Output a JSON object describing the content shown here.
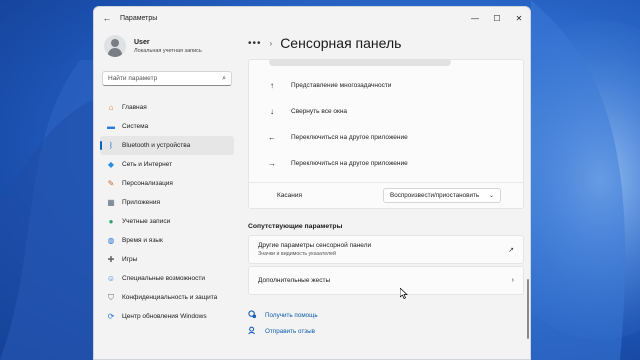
{
  "window": {
    "app_title": "Параметры",
    "back_icon": "←",
    "controls": {
      "minimize": "—",
      "maximize": "☐",
      "close": "✕"
    }
  },
  "user": {
    "name": "User",
    "account_type": "Локальная учетная запись"
  },
  "search": {
    "placeholder": "Найти параметр",
    "icon": "⌕"
  },
  "sidebar": {
    "items": [
      {
        "label": "Главная",
        "icon": "home-icon",
        "glyph": "⌂",
        "color": "#e07b39",
        "active": false
      },
      {
        "label": "Система",
        "icon": "monitor-icon",
        "glyph": "▬",
        "color": "#2a7ad6",
        "active": false
      },
      {
        "label": "Bluetooth и устройства",
        "icon": "bluetooth-icon",
        "glyph": "ᛒ",
        "color": "#2a7ad6",
        "active": true
      },
      {
        "label": "Сеть и Интернет",
        "icon": "wifi-icon",
        "glyph": "◆",
        "color": "#2a8ee0",
        "active": false
      },
      {
        "label": "Персонализация",
        "icon": "brush-icon",
        "glyph": "✎",
        "color": "#c06a35",
        "active": false
      },
      {
        "label": "Приложения",
        "icon": "apps-icon",
        "glyph": "▦",
        "color": "#5b6b7c",
        "active": false
      },
      {
        "label": "Учетные записи",
        "icon": "accounts-icon",
        "glyph": "●",
        "color": "#2fa36a",
        "active": false
      },
      {
        "label": "Время и язык",
        "icon": "globe-icon",
        "glyph": "◍",
        "color": "#2a7ad6",
        "active": false
      },
      {
        "label": "Игры",
        "icon": "gamepad-icon",
        "glyph": "✚",
        "color": "#666666",
        "active": false
      },
      {
        "label": "Специальные возможности",
        "icon": "accessibility-icon",
        "glyph": "☺",
        "color": "#2a7ad6",
        "active": false
      },
      {
        "label": "Конфиденциальность и защита",
        "icon": "shield-icon",
        "glyph": "⛉",
        "color": "#6b6b6b",
        "active": false
      },
      {
        "label": "Центр обновления Windows",
        "icon": "update-icon",
        "glyph": "⟳",
        "color": "#2a7ad6",
        "active": false
      }
    ]
  },
  "breadcrumb": {
    "more": "•••",
    "separator": "›",
    "title": "Сенсорная панель"
  },
  "gestures": [
    {
      "arrow": "↑",
      "label": "Представление многозадачности"
    },
    {
      "arrow": "↓",
      "label": "Свернуть все окна"
    },
    {
      "arrow": "←",
      "label": "Переключиться на другое приложение"
    },
    {
      "arrow": "→",
      "label": "Переключиться на другое приложение"
    }
  ],
  "taps": {
    "label": "Касания",
    "value": "Воспроизвести/приостановить",
    "chevron": "⌄"
  },
  "related": {
    "heading": "Сопутствующие параметры",
    "items": [
      {
        "title": "Другие параметры сенсорной панели",
        "subtitle": "Значки и видимость указателей",
        "icon": "↗"
      },
      {
        "title": "Дополнительные жесты",
        "subtitle": "",
        "icon": "›"
      }
    ]
  },
  "help": {
    "get_help": "Получить помощь",
    "feedback": "Отправить отзыв"
  },
  "colors": {
    "accent": "#0067c0",
    "link": "#0b5cad"
  }
}
